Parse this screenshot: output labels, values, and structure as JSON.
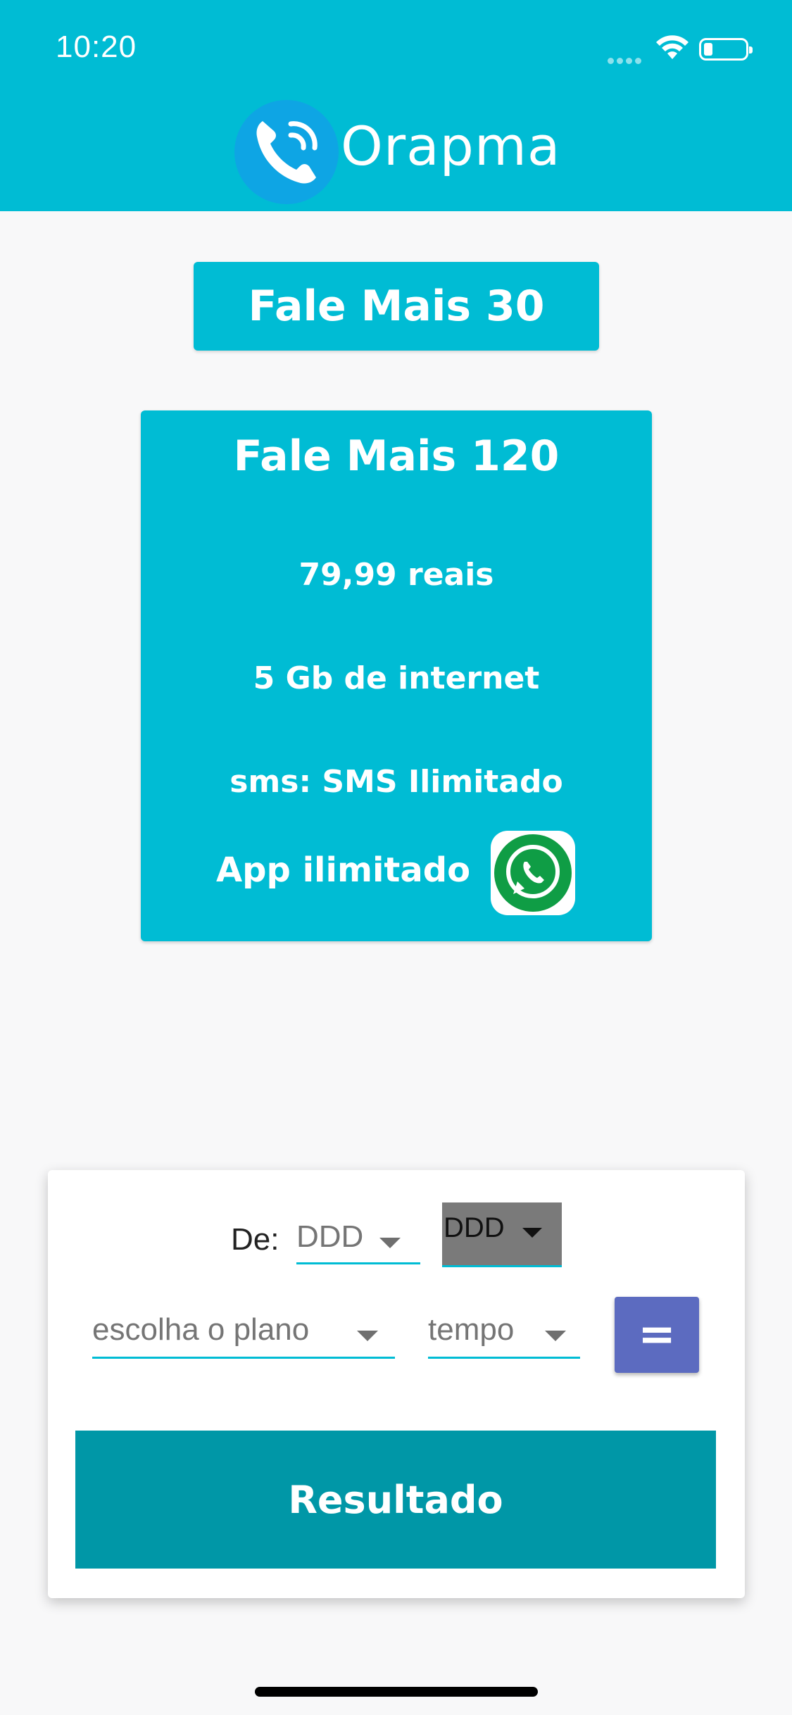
{
  "status_bar": {
    "time": "10:20"
  },
  "header": {
    "app_name": "Orapma",
    "logo_icon": "phone-icon",
    "color": "#00bcd4"
  },
  "plans": {
    "tab_label": "Fale Mais 30",
    "card": {
      "title": "Fale Mais 120",
      "price": "79,99 reais",
      "internet": "5 Gb de internet",
      "sms": "sms: SMS Ilimitado",
      "app": "App ilimitado",
      "app_icon": "whatsapp-icon"
    }
  },
  "form": {
    "from_label": "De:",
    "from_ddd_placeholder": "DDD",
    "to_ddd_value": "DDD",
    "plan_placeholder": "escolha o plano",
    "time_placeholder": "tempo",
    "equals_label": "=",
    "result_label": "Resultado"
  },
  "colors": {
    "primary": "#00bcd4",
    "accent_button": "#5c6bc0",
    "result_button": "#0097a7",
    "background": "#f8f8f9"
  }
}
